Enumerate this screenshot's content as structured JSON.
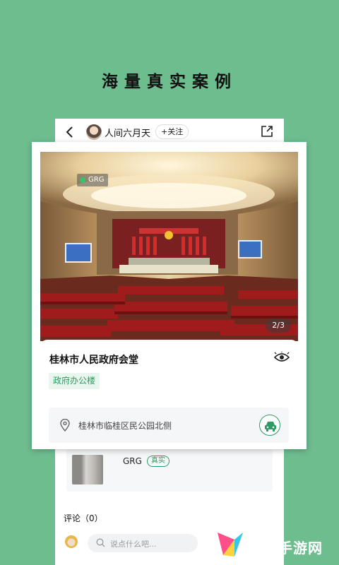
{
  "headline": "海量真实案例",
  "header": {
    "username": "人间六月天",
    "follow_label": "+关注"
  },
  "case": {
    "image_tag": "GRG",
    "image_counter": "2/3",
    "title": "桂林市人民政府会堂",
    "category": "政府办公楼",
    "address": "桂林市临桂区民公园北侧"
  },
  "related": {
    "label": "GRG",
    "badge": "真实"
  },
  "comments": {
    "title": "评论（0）",
    "placeholder": "说点什么吧..."
  },
  "watermark": {
    "text": "甘露手游网"
  },
  "colors": {
    "background": "#6dbd8f",
    "accent": "#2e9b62"
  },
  "icons": [
    "back-arrow-icon",
    "share-icon",
    "eye-icon",
    "location-pin-icon",
    "car-icon",
    "search-icon"
  ]
}
